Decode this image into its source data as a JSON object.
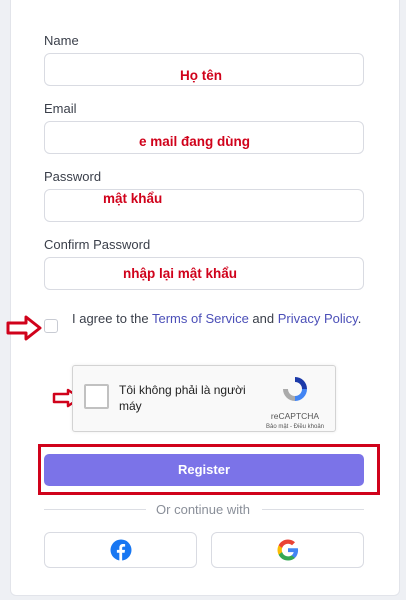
{
  "form": {
    "name_label": "Name",
    "email_label": "Email",
    "password_label": "Password",
    "confirm_label": "Confirm Password",
    "name_value": "",
    "email_value": "",
    "password_value": "",
    "confirm_value": ""
  },
  "annotations": {
    "name": "Họ tên",
    "email": "e mail đang dùng",
    "password": "mật khẩu",
    "confirm": "nhập lại mật khẩu",
    "color": "#d0021b"
  },
  "agree": {
    "prefix": "I agree to the ",
    "terms_link": "Terms of Service",
    "middle": " and ",
    "privacy_link": "Privacy Policy",
    "suffix": "."
  },
  "captcha": {
    "text": "Tôi không phải là người máy",
    "brand": "reCAPTCHA",
    "links": "Bảo mật - Điều khoản"
  },
  "register_label": "Register",
  "divider_text": "Or continue with",
  "social": [
    {
      "name": "facebook",
      "icon": "facebook-icon",
      "color": "#1877f2"
    },
    {
      "name": "google",
      "icon": "google-icon"
    }
  ],
  "colors": {
    "accent": "#7b73e8",
    "link": "#4b4fb8",
    "highlight": "#d0021b"
  }
}
